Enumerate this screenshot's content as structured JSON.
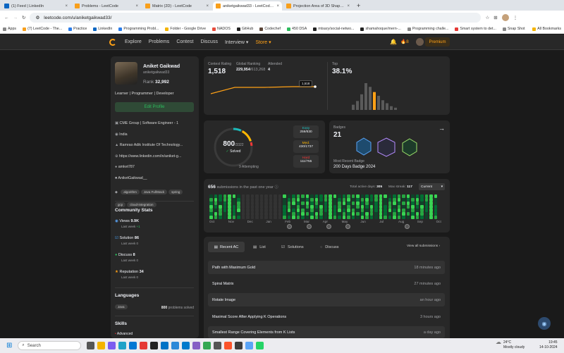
{
  "browser": {
    "tabs": [
      {
        "label": "(1) Feed | LinkedIn",
        "color": "#0a66c2"
      },
      {
        "label": "Problems - LeetCode",
        "color": "#f89f1b"
      },
      {
        "label": "Matrix (2D) - LeetCode",
        "color": "#f89f1b"
      },
      {
        "label": "aniketgaikwad33 - LeetCode P...",
        "color": "#f89f1b"
      },
      {
        "label": "Projection Area of 3D Shapes -...",
        "color": "#f89f1b"
      }
    ],
    "new_tab": "+",
    "url": "leetcode.com/u/aniketgaikwad33/",
    "bookmarks": [
      "Apps",
      "(7) LeetCode - The...",
      "Practice",
      "LinkedIn",
      "Programming Probl...",
      "Folder - Google Drive",
      "NADOS",
      "GitHub",
      "Codechef",
      "450 DSA",
      "mtsary/social-netwo...",
      "shamahoque/mern-...",
      "Programming challe...",
      "Smart system to det...",
      "Snap Shot"
    ],
    "all_bookmarks": "All Bookmarks"
  },
  "nav": {
    "items": [
      "Explore",
      "Problems",
      "Contest",
      "Discuss",
      "Interview",
      "Store"
    ],
    "streak": "8",
    "premium": "Premium"
  },
  "profile": {
    "name": "Aniket Gaikwad",
    "username": "aniketgaikwad33",
    "rank_label": "Rank",
    "rank": "32,992",
    "bio": "Learner | Programmer | Developer",
    "edit_button": "Edit Profile",
    "info": [
      {
        "icon": "briefcase-icon",
        "text": "CME Group | Software Engineer - 1"
      },
      {
        "icon": "location-icon",
        "text": "India"
      },
      {
        "icon": "school-icon",
        "text": "Ramrao Adik Institute Of Technology..."
      },
      {
        "icon": "link-icon",
        "text": "https://www.linkedin.com/in/aniket-g..."
      },
      {
        "icon": "github-icon",
        "text": "amket787"
      },
      {
        "icon": "linkedin-icon",
        "text": "AniketGaikwad__"
      }
    ],
    "tags": [
      "algorithm",
      "Java FullStack",
      "spring",
      "gcp",
      "cloud-integration"
    ]
  },
  "community": {
    "title": "Community Stats",
    "stats": [
      {
        "icon": "eye-icon",
        "label": "Views",
        "value": "9.9K",
        "sub": "Last week",
        "delta": "+1",
        "color": "#5aa4f7"
      },
      {
        "icon": "check-icon",
        "label": "Solution",
        "value": "86",
        "sub": "Last week",
        "delta": "0",
        "color": "#4aa3f5"
      },
      {
        "icon": "chat-icon",
        "label": "Discuss",
        "value": "8",
        "sub": "Last week",
        "delta": "0",
        "color": "#2cbb5d"
      },
      {
        "icon": "star-icon",
        "label": "Reputation",
        "value": "34",
        "sub": "Last week",
        "delta": "0",
        "color": "#ffa116"
      }
    ]
  },
  "languages": {
    "title": "Languages",
    "items": [
      {
        "name": "Java",
        "count": "800",
        "suffix": "problems solved"
      }
    ]
  },
  "skills": {
    "title": "Skills",
    "level": "Advanced"
  },
  "contest": {
    "rating_label": "Contest Rating",
    "rating": "1,518",
    "global_label": "Global Ranking",
    "global": "229,954",
    "global_total": "/613,268",
    "attended_label": "Attended",
    "attended": "4",
    "tooltip": "1,518",
    "top_label": "Top",
    "top": "38.1%"
  },
  "chart_data": {
    "type": "bar",
    "categories": [
      "b1",
      "b2",
      "b3",
      "b4",
      "b5",
      "b6",
      "b7",
      "b8",
      "b9",
      "b10",
      "b11"
    ],
    "values": [
      0.7,
      1.2,
      2.1,
      3.6,
      3.1,
      2.4,
      1.9,
      1.3,
      0.9,
      0.5,
      0.3
    ],
    "highlight_index": 5,
    "colors": {
      "bar": "#5a5a5a",
      "highlight": "#ffa116"
    }
  },
  "solved": {
    "count": "800",
    "total": "/3322",
    "label": "Solved",
    "attempting": "9 Attempting",
    "difficulties": [
      {
        "name": "Easy",
        "value": "259/830",
        "color": "#1cbaba"
      },
      {
        "name": "Med.",
        "value": "430/1737",
        "color": "#ffb700"
      },
      {
        "name": "Hard",
        "value": "111/755",
        "color": "#f63737"
      }
    ]
  },
  "badges": {
    "label": "Badges",
    "count": "21",
    "recent_label": "Most Recent Badge",
    "recent": "200 Days Badge 2024"
  },
  "heatmap": {
    "count": "656",
    "label": "submissions in the past one year",
    "active_label": "Total active days:",
    "active": "305",
    "streak_label": "Max streak:",
    "streak": "117",
    "select": "Current",
    "months": [
      "Oct",
      "Nov",
      "Dec",
      "Jan",
      "Feb",
      "Mar",
      "Apr",
      "May",
      "Jun",
      "Jul",
      "Aug",
      "Sep",
      "Oct"
    ]
  },
  "recent": {
    "tabs": [
      "Recent AC",
      "List",
      "Solutions",
      "Discuss"
    ],
    "view_all": "View all submissions",
    "items": [
      {
        "title": "Path with Maximum Gold",
        "time": "18 minutes ago"
      },
      {
        "title": "Spiral Matrix",
        "time": "27 minutes ago"
      },
      {
        "title": "Rotate Image",
        "time": "an hour ago"
      },
      {
        "title": "Maximal Score After Applying K Operations",
        "time": "3 hours ago"
      },
      {
        "title": "Smallest Range Covering Elements from K Lists",
        "time": "a day ago"
      }
    ]
  },
  "taskbar": {
    "search": "Search",
    "temp": "24°C",
    "weather": "Mostly cloudy",
    "time": "19:45",
    "date": "14-10-2024"
  }
}
